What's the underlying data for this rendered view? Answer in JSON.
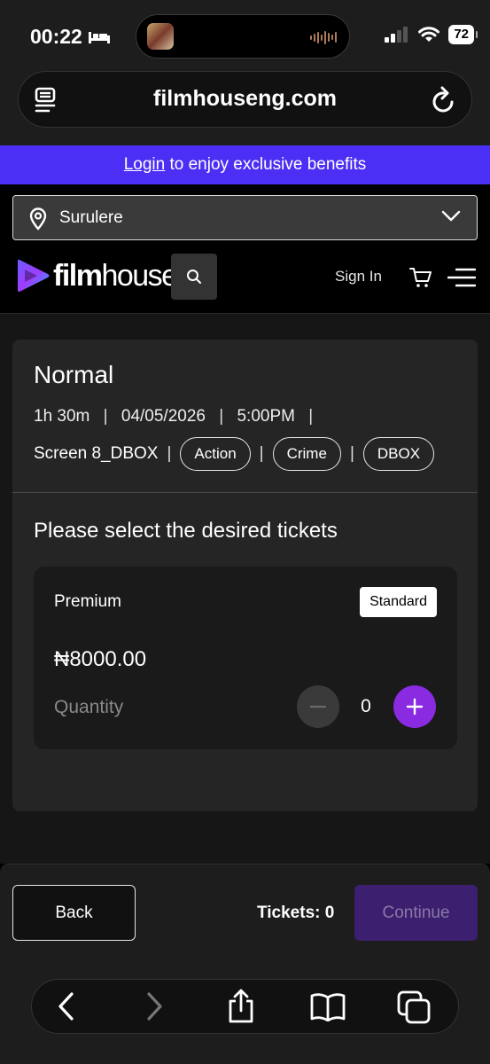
{
  "status_bar": {
    "time": "00:22",
    "battery": "72"
  },
  "browser": {
    "url": "filmhouseng.com"
  },
  "banner": {
    "link_text": "Login",
    "text": " to enjoy exclusive benefits"
  },
  "header": {
    "location": "Surulere",
    "logo_bold": "film",
    "logo_light": "house",
    "logo_plus": "+",
    "sign_in": "Sign In"
  },
  "showing": {
    "title": "Normal",
    "duration": "1h 30m",
    "date": "04/05/2026",
    "time": "5:00PM",
    "screen": "Screen 8_DBOX",
    "separator": "|",
    "tags": [
      "Action",
      "Crime",
      "DBOX"
    ]
  },
  "ticket_selection": {
    "prompt": "Please select the desired tickets",
    "ticket": {
      "name": "Premium",
      "badge": "Standard",
      "price": "₦8000.00",
      "quantity_label": "Quantity",
      "quantity": "0"
    }
  },
  "footer": {
    "back_label": "Back",
    "tickets_label": "Tickets: 0",
    "continue_label": "Continue"
  },
  "colors": {
    "banner": "#4c2ff5",
    "accent_purple": "#8a2be2",
    "continue_disabled": "#3c1f6e"
  }
}
